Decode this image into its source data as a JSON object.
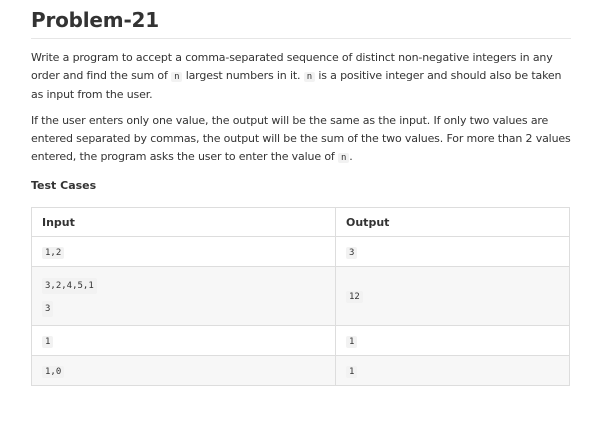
{
  "title": "Problem-21",
  "para1": {
    "t1": "Write a program to accept a comma-separated sequence of distinct non-negative integers in any order and find the sum of ",
    "code1": "n",
    "t2": " largest numbers in it. ",
    "code2": "n",
    "t3": " is a positive integer and should also be taken as input from the user."
  },
  "para2": {
    "t1": "If the user enters only one value, the output will be the same as the input. If only two values are entered separated by commas, the output will be the sum of the two values. For more than 2 values entered, the program asks the user to enter the value of ",
    "code1": "n",
    "t2": "."
  },
  "test_cases_heading": "Test Cases",
  "table": {
    "headers": {
      "input": "Input",
      "output": "Output"
    },
    "rows": [
      {
        "input": [
          "1,2"
        ],
        "output": "3"
      },
      {
        "input": [
          "3,2,4,5,1",
          "3"
        ],
        "output": "12"
      },
      {
        "input": [
          "1"
        ],
        "output": "1"
      },
      {
        "input": [
          "1,0"
        ],
        "output": "1"
      }
    ]
  }
}
